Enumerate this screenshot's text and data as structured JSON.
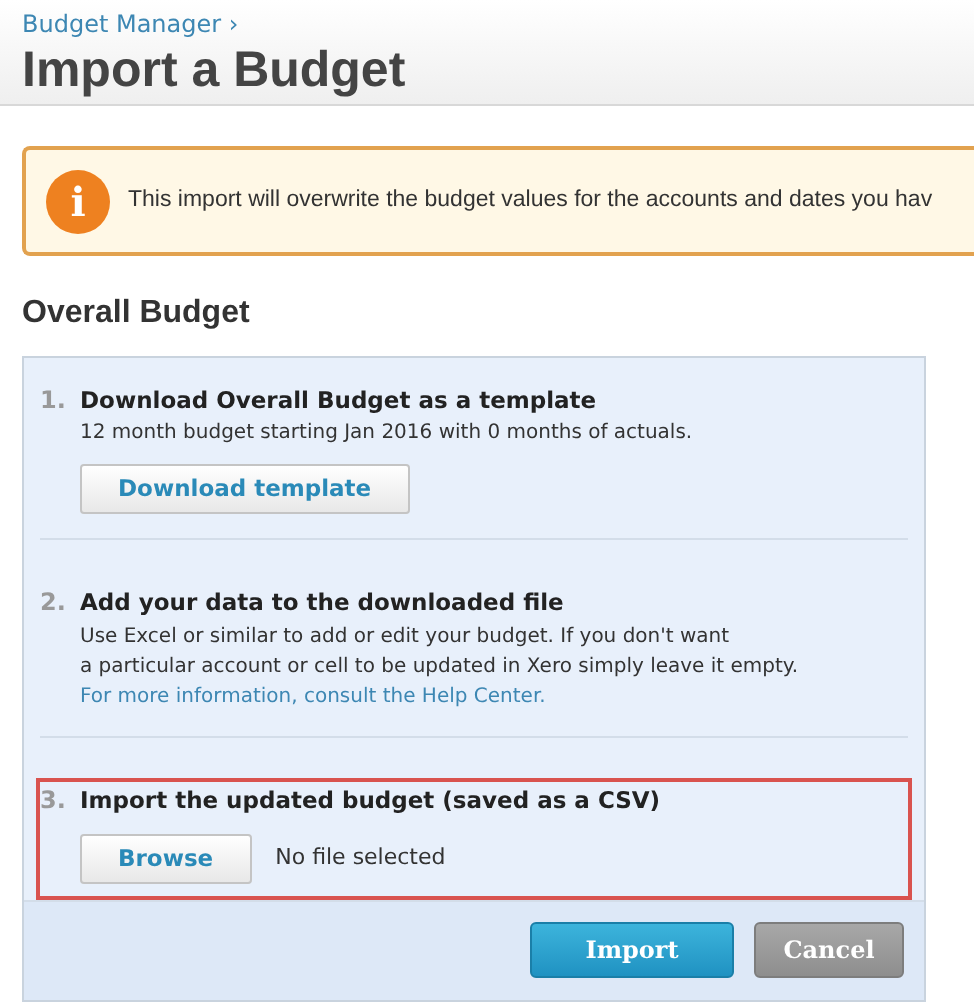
{
  "breadcrumb": "Budget Manager ›",
  "title": "Import a Budget",
  "alert": {
    "icon": "i",
    "text": "This import will overwrite the budget values for the accounts and dates you hav"
  },
  "section_title": "Overall Budget",
  "steps": [
    {
      "number": "1.",
      "title": "Download Overall Budget as a template",
      "highlighted": false,
      "lines": [
        "12 month budget starting Jan 2016 with 0 months of actuals."
      ],
      "button": "Download template"
    },
    {
      "number": "2.",
      "title": "Add your data to the downloaded file",
      "highlighted": false,
      "lines": [
        "Use Excel or similar to add or edit your budget. If you don't want",
        "a particular account or cell to be updated in Xero simply leave it empty."
      ],
      "link": "For more information, consult the Help Center."
    },
    {
      "number": "3.",
      "title": "Import the updated budget (saved as a CSV)",
      "highlighted": true,
      "button": "Browse",
      "file_status": "No file selected"
    }
  ],
  "buttons": [
    {
      "label": "Import",
      "kind": "primary"
    },
    {
      "label": "Cancel",
      "kind": "secondary"
    }
  ]
}
